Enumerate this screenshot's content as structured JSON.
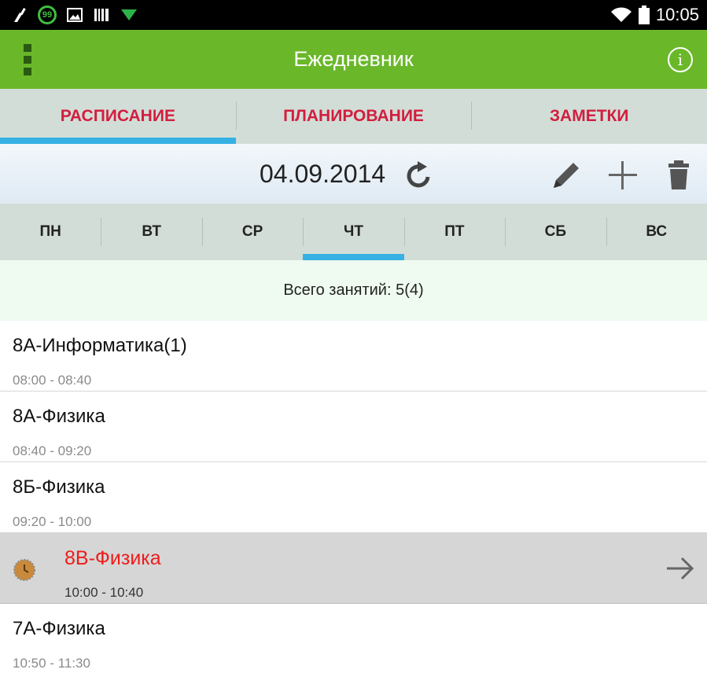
{
  "status_bar": {
    "battery_badge": "99",
    "clock": "10:05",
    "icons": [
      "broom-icon",
      "battery-saver-icon",
      "image-icon",
      "barcode-icon",
      "send-icon",
      "wifi-icon",
      "battery-icon"
    ]
  },
  "app_bar": {
    "title": "Ежедневник",
    "menu_icon": "overflow-menu-icon",
    "info_icon": "info-icon",
    "info_glyph": "i",
    "color": "#6ab82a"
  },
  "tabs": [
    {
      "label": "РАСПИСАНИЕ",
      "active": true
    },
    {
      "label": "ПЛАНИРОВАНИЕ",
      "active": false
    },
    {
      "label": "ЗАМЕТКИ",
      "active": false
    }
  ],
  "date_toolbar": {
    "date": "04.09.2014",
    "icons": [
      "refresh-icon",
      "pencil-icon",
      "plus-icon",
      "trash-icon"
    ]
  },
  "days": [
    {
      "label": "ПН",
      "active": false
    },
    {
      "label": "ВТ",
      "active": false
    },
    {
      "label": "СР",
      "active": false
    },
    {
      "label": "ЧТ",
      "active": true
    },
    {
      "label": "ПТ",
      "active": false
    },
    {
      "label": "СБ",
      "active": false
    },
    {
      "label": "ВС",
      "active": false
    }
  ],
  "summary": "Всего занятий: 5(4)",
  "lessons": [
    {
      "title": "8А-Информатика(1)",
      "time": "08:00 - 08:40",
      "current": false
    },
    {
      "title": "8А-Физика",
      "time": "08:40 - 09:20",
      "current": false
    },
    {
      "title": "8Б-Физика",
      "time": "09:20 - 10:00",
      "current": false
    },
    {
      "title": "8В-Физика",
      "time": "10:00 - 10:40",
      "current": true
    },
    {
      "title": "7А-Физика",
      "time": "10:50 - 11:30",
      "current": false
    }
  ],
  "colors": {
    "accent_tab": "#d21e3e",
    "indicator": "#35b1e4",
    "current_lesson": "#ee1c1c"
  }
}
